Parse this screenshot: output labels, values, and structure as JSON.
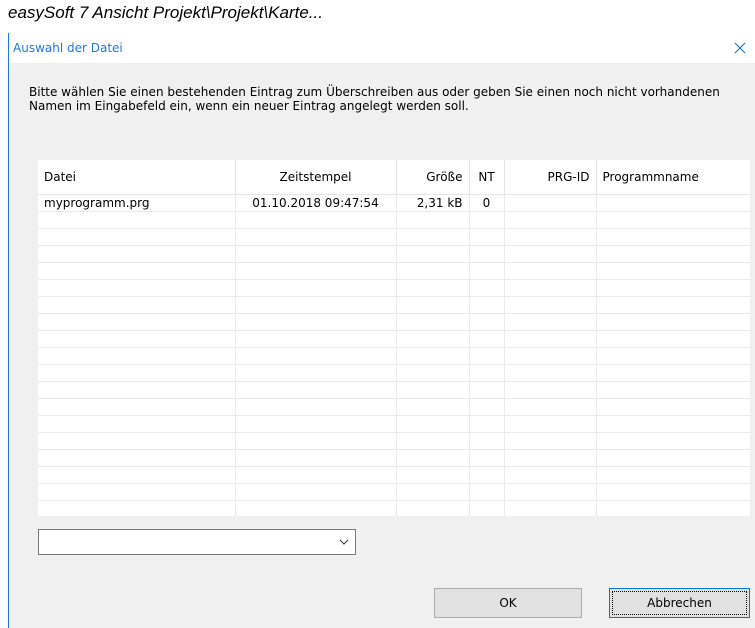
{
  "caption": "easySoft 7 Ansicht Projekt\\Projekt\\Karte...",
  "dialog": {
    "title": "Auswahl der Datei",
    "description_line1": "Bitte wählen Sie einen bestehenden Eintrag zum Überschreiben aus oder geben Sie einen noch nicht vorhandenen",
    "description_line2": "Namen im Eingabefeld ein, wenn ein neuer Eintrag angelegt werden soll.",
    "close_icon": "close-icon"
  },
  "table": {
    "columns": [
      "Datei",
      "Zeitstempel",
      "Größe",
      "NT",
      "PRG-ID",
      "Programmname"
    ],
    "rows": [
      [
        "myprogramm.prg",
        "01.10.2018 09:47:54",
        "2,31 kB",
        "0",
        "",
        ""
      ]
    ]
  },
  "filename_combo": {
    "value": "",
    "arrow_icon": "chevron-down-icon"
  },
  "buttons": {
    "ok": "OK",
    "cancel": "Abbrechen"
  }
}
